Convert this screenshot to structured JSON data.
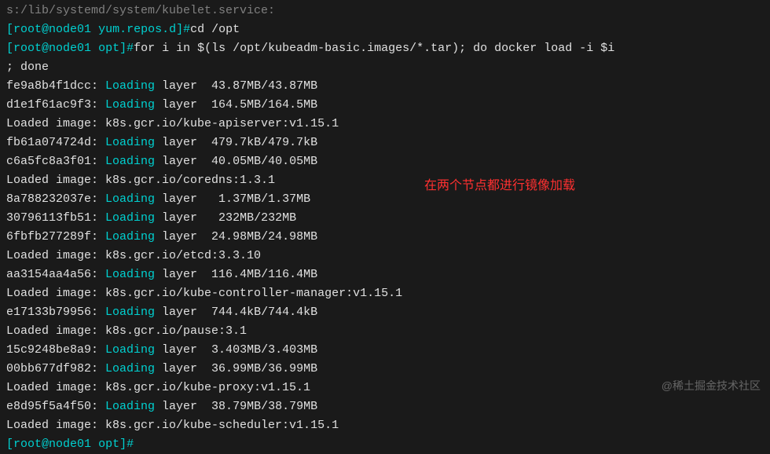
{
  "lines": {
    "topGray": "s:/lib/systemd/system/kubelet.service:",
    "prompt1": {
      "user": "root",
      "host": "node01",
      "path": "yum.repos.d",
      "cmd": "cd /opt"
    },
    "prompt2": {
      "user": "root",
      "host": "node01",
      "path": "opt",
      "cmd": "for i in $(ls /opt/kubeadm-basic.images/*.tar); do docker load -i $i\n; done"
    },
    "load": [
      {
        "hash": "fe9a8b4f1dcc:",
        "action": "Loading",
        "text": " layer  43.87MB/43.87MB"
      },
      {
        "hash": "d1e1f61ac9f3:",
        "action": "Loading",
        "text": " layer  164.5MB/164.5MB"
      },
      {
        "plain": "Loaded image: k8s.gcr.io/kube-apiserver:v1.15.1"
      },
      {
        "hash": "fb61a074724d:",
        "action": "Loading",
        "text": " layer  479.7kB/479.7kB"
      },
      {
        "hash": "c6a5fc8a3f01:",
        "action": "Loading",
        "text": " layer  40.05MB/40.05MB"
      },
      {
        "plain": "Loaded image: k8s.gcr.io/coredns:1.3.1"
      },
      {
        "hash": "8a788232037e:",
        "action": "Loading",
        "text": " layer   1.37MB/1.37MB"
      },
      {
        "hash": "30796113fb51:",
        "action": "Loading",
        "text": " layer   232MB/232MB"
      },
      {
        "hash": "6fbfb277289f:",
        "action": "Loading",
        "text": " layer  24.98MB/24.98MB"
      },
      {
        "plain": "Loaded image: k8s.gcr.io/etcd:3.3.10"
      },
      {
        "hash": "aa3154aa4a56:",
        "action": "Loading",
        "text": " layer  116.4MB/116.4MB"
      },
      {
        "plain": "Loaded image: k8s.gcr.io/kube-controller-manager:v1.15.1"
      },
      {
        "hash": "e17133b79956:",
        "action": "Loading",
        "text": " layer  744.4kB/744.4kB"
      },
      {
        "plain": "Loaded image: k8s.gcr.io/pause:3.1"
      },
      {
        "hash": "15c9248be8a9:",
        "action": "Loading",
        "text": " layer  3.403MB/3.403MB"
      },
      {
        "hash": "00bb677df982:",
        "action": "Loading",
        "text": " layer  36.99MB/36.99MB"
      },
      {
        "plain": "Loaded image: k8s.gcr.io/kube-proxy:v1.15.1"
      },
      {
        "hash": "e8d95f5a4f50:",
        "action": "Loading",
        "text": " layer  38.79MB/38.79MB"
      },
      {
        "plain": "Loaded image: k8s.gcr.io/kube-scheduler:v1.15.1"
      }
    ],
    "prompt3": {
      "user": "root",
      "host": "node01",
      "path": "opt",
      "cmd": ""
    }
  },
  "annotation": "在两个节点都进行镜像加载",
  "watermark": "@稀土掘金技术社区"
}
